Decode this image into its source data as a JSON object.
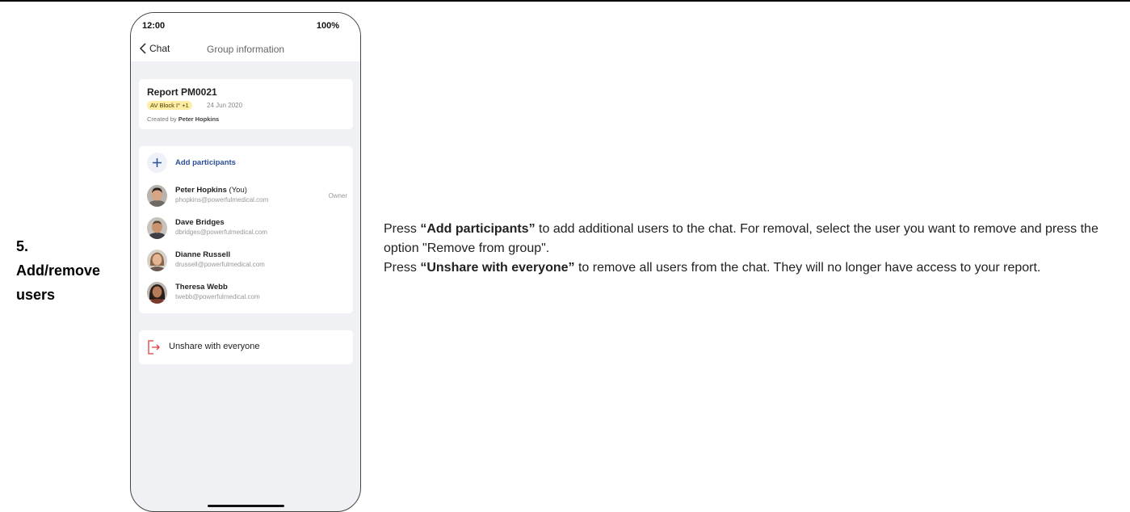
{
  "step": {
    "number": "5.",
    "title_line1": "Add/remove",
    "title_line2": "users"
  },
  "phone": {
    "status": {
      "time": "12:00",
      "battery": "100%"
    },
    "nav": {
      "back_label": "Chat",
      "title": "Group information"
    },
    "report": {
      "title": "Report PM0021",
      "tag": "AV Block I° +1",
      "date": "24 Jun 2020",
      "created_prefix": "Created by",
      "created_by": "Peter Hopkins"
    },
    "add_participants_label": "Add participants",
    "participants": [
      {
        "name": "Peter Hopkins",
        "suffix": "(You)",
        "email": "phopkins@powerfulmedical.com",
        "role": "Owner",
        "avatar": "avatar-man-dark-hair"
      },
      {
        "name": "Dave Bridges",
        "suffix": "",
        "email": "dbridges@powerfulmedical.com",
        "role": "",
        "avatar": "avatar-man-bald"
      },
      {
        "name": "Dianne Russell",
        "suffix": "",
        "email": "drussell@powerfulmedical.com",
        "role": "",
        "avatar": "avatar-woman-light-hair"
      },
      {
        "name": "Theresa Webb",
        "suffix": "",
        "email": "twebb@powerfulmedical.com",
        "role": "",
        "avatar": "avatar-woman-dark-hair"
      }
    ],
    "unshare_label": "Unshare with everyone"
  },
  "description": {
    "p1_bold": "“Add participants”",
    "p1_pre": "Press ",
    "p1_rest": " to add additional users to the chat. For removal, select the user you want to remove and press the option \"Remove from group\".",
    "p2_pre": "Press ",
    "p2_bold": "“Unshare with everyone”",
    "p2_rest": " to remove all users from the chat. They will no longer have access to your report."
  },
  "colors": {
    "accent": "#2a4f9c",
    "tag_bg": "#fdeea3",
    "unshare_icon": "#e03b3b",
    "phone_bg": "#f0f1f4"
  }
}
